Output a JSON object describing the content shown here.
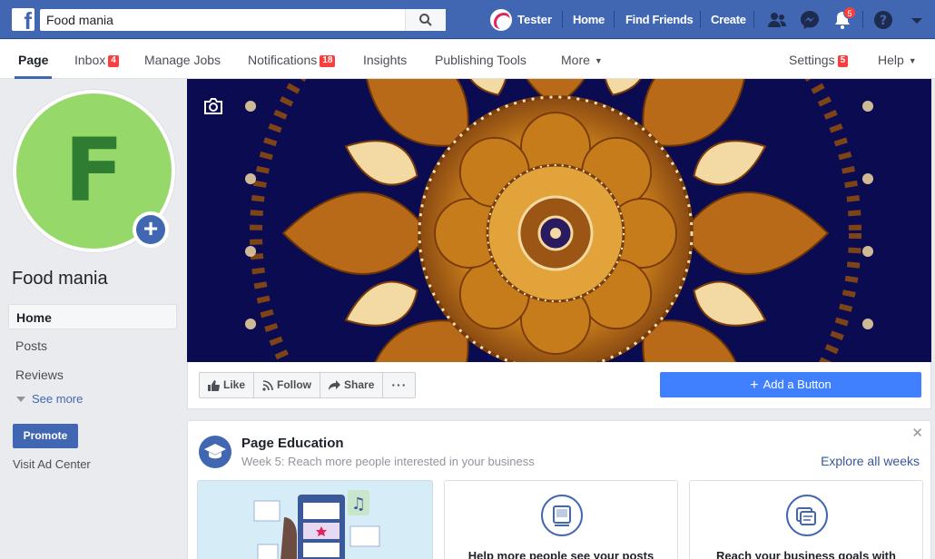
{
  "topbar": {
    "search_value": "Food mania",
    "user_name": "Tester",
    "links": [
      "Home",
      "Find Friends",
      "Create"
    ],
    "notification_count": "5",
    "icons": [
      "facebook-logo",
      "search-icon",
      "friends-icon",
      "messenger-icon",
      "notifications-icon",
      "help-icon",
      "account-menu-caret"
    ],
    "color_primary": "#4267b2"
  },
  "pagenav": {
    "items": [
      {
        "label": "Page",
        "badge": ""
      },
      {
        "label": "Inbox",
        "badge": "4"
      },
      {
        "label": "Manage Jobs",
        "badge": ""
      },
      {
        "label": "Notifications",
        "badge": "18"
      },
      {
        "label": "Insights",
        "badge": ""
      },
      {
        "label": "Publishing Tools",
        "badge": ""
      },
      {
        "label": "More",
        "badge": ""
      }
    ],
    "settings": {
      "label": "Settings",
      "badge": "5"
    },
    "help": "Help"
  },
  "sidebar": {
    "profile_letter": "F",
    "page_name": "Food mania",
    "items": [
      "Home",
      "Posts",
      "Reviews"
    ],
    "see_more": "See more",
    "promote": "Promote",
    "ad_center": "Visit Ad Center"
  },
  "actions": {
    "like": "Like",
    "follow": "Follow",
    "share": "Share",
    "more": "···",
    "add_button": "Add a Button"
  },
  "education": {
    "title": "Page Education",
    "subtitle": "Week 5: Reach more people interested in your business",
    "explore": "Explore all weeks",
    "close": "✕",
    "cards": [
      "Help more people see your posts",
      "Reach your business goals with"
    ]
  }
}
